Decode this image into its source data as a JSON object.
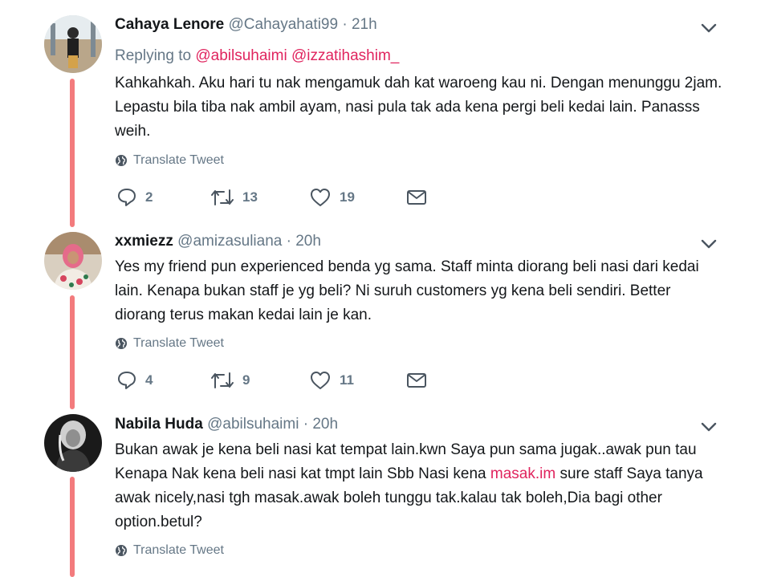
{
  "tweets": [
    {
      "name": "Cahaya Lenore",
      "handle": "@Cahayahati99",
      "dot": "·",
      "time": "21h",
      "replying_label": "Replying to",
      "replying_mentions": [
        "@abilsuhaimi",
        "@izzatihashim_"
      ],
      "text": "Kahkahkah. Aku hari tu nak mengamuk dah kat waroeng kau ni. Dengan menunggu 2jam. Lepastu bila tiba nak ambil ayam, nasi pula tak ada kena pergi beli kedai lain. Panasss weih.",
      "translate": "Translate Tweet",
      "replies": "2",
      "retweets": "13",
      "likes": "19"
    },
    {
      "name": "xxmiezz",
      "handle": "@amizasuliana",
      "dot": "·",
      "time": "20h",
      "text": "Yes my friend pun experienced benda yg sama. Staff minta diorang beli nasi dari kedai lain. Kenapa bukan staff je yg beli? Ni suruh customers yg kena beli sendiri. Better diorang terus makan kedai lain je kan.",
      "translate": "Translate Tweet",
      "replies": "4",
      "retweets": "9",
      "likes": "11"
    },
    {
      "name": "Nabila Huda",
      "handle": "@abilsuhaimi",
      "dot": "·",
      "time": "20h",
      "text_before_link": "Bukan awak je kena beli nasi kat tempat lain.kwn Saya pun sama jugak..awak pun tau Kenapa Nak kena beli nasi kat tmpt lain Sbb Nasi kena ",
      "link": "masak.im",
      "text_after_link": " sure staff Saya tanya awak nicely,nasi tgh masak.awak boleh tunggu tak.kalau tak boleh,Dia bagi other option.betul?",
      "translate": "Translate Tweet"
    }
  ],
  "colors": {
    "accent": "#e0245e",
    "thread_line": "#f37b7d",
    "muted": "#657786",
    "text": "#14171a"
  },
  "icons": [
    "chevron-down-icon",
    "globe-icon",
    "reply-icon",
    "retweet-icon",
    "like-icon",
    "dm-icon"
  ]
}
